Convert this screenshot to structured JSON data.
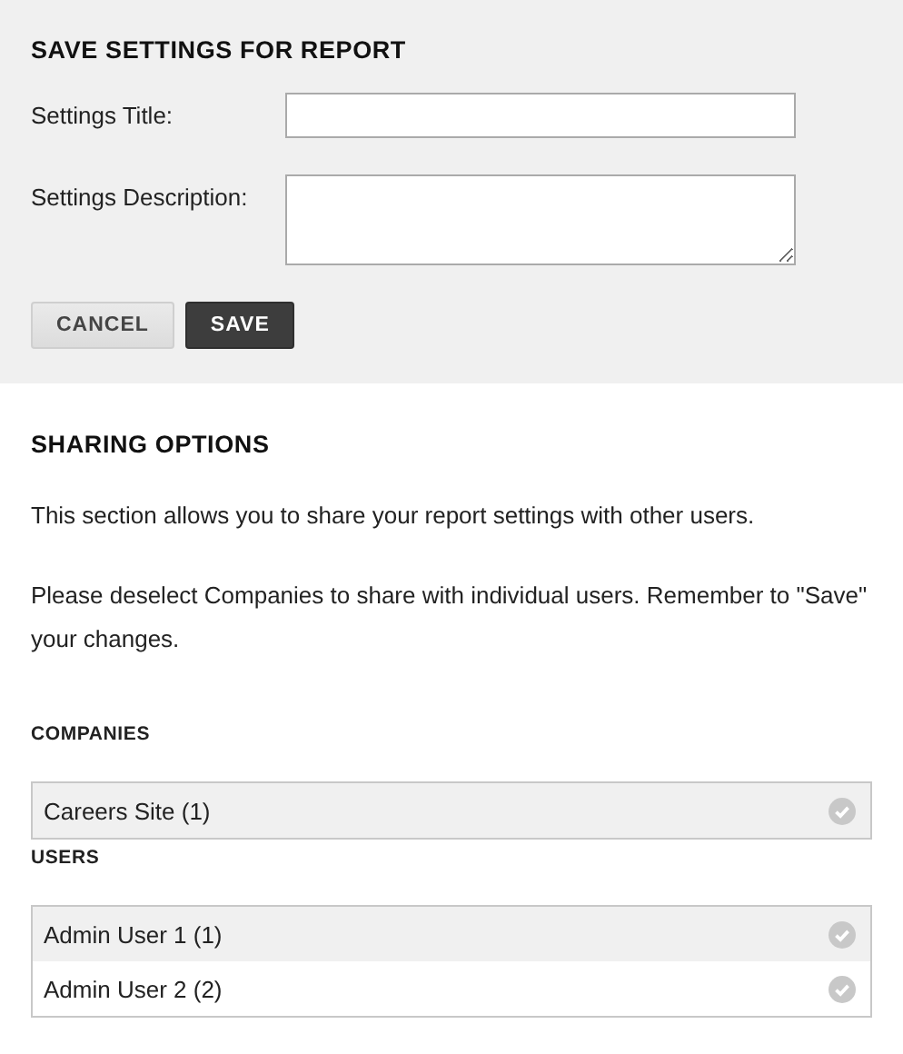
{
  "save_panel": {
    "title": "SAVE SETTINGS FOR REPORT",
    "fields": [
      {
        "label": "Settings Title:",
        "kind": "input"
      },
      {
        "label": "Settings Description:",
        "kind": "textarea"
      }
    ],
    "buttons": [
      {
        "label": "CANCEL",
        "kind": "secondary"
      },
      {
        "label": "SAVE",
        "kind": "primary"
      }
    ]
  },
  "sharing": {
    "title": "SHARING OPTIONS",
    "paragraphs": [
      "This section allows you to share your report settings with other users.",
      "Please deselect Companies to share with individual users. Remember to \"Save\" your changes."
    ],
    "groups": [
      {
        "heading": "COMPANIES",
        "items": [
          "Careers Site (1)"
        ]
      },
      {
        "heading": "USERS",
        "items": [
          "Admin User 1 (1)",
          "Admin User 2 (2)"
        ]
      }
    ]
  }
}
